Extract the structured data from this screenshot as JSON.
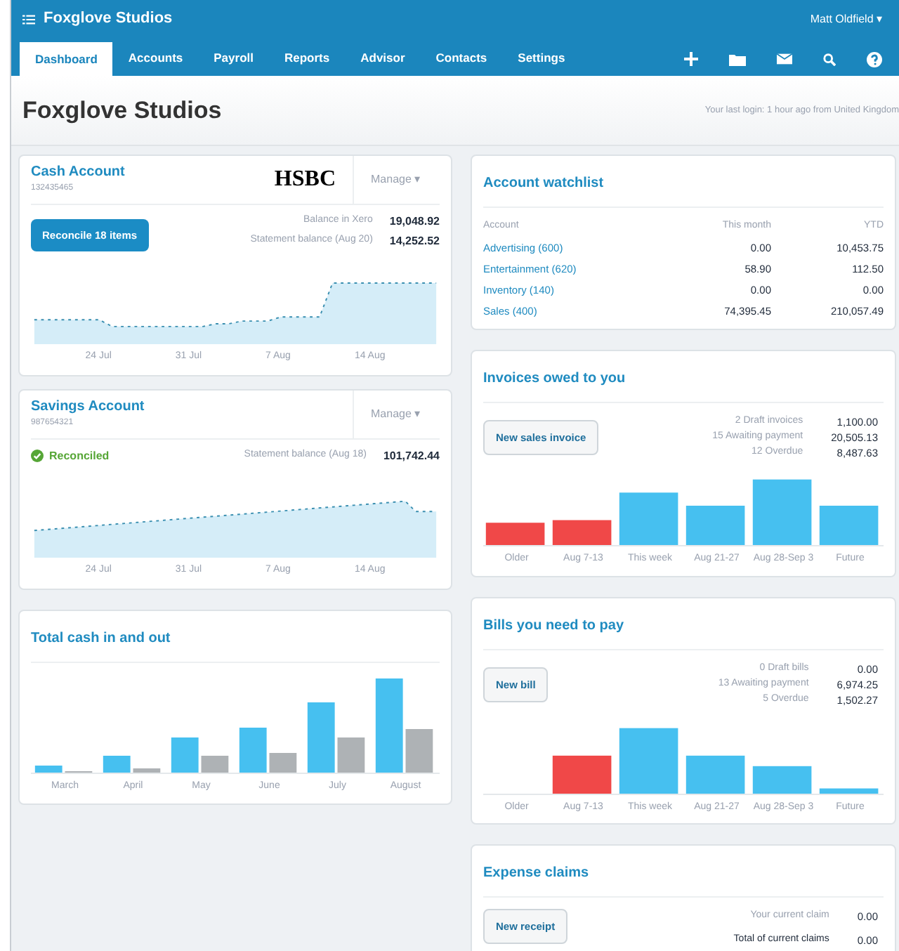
{
  "header": {
    "org": "Foxglove Studios",
    "user": "Matt Oldfield",
    "user_caret": "▾"
  },
  "nav": [
    {
      "label": "Dashboard",
      "selected": true
    },
    {
      "label": "Accounts",
      "selected": false
    },
    {
      "label": "Payroll",
      "selected": false
    },
    {
      "label": "Reports",
      "selected": false
    },
    {
      "label": "Advisor",
      "selected": false
    },
    {
      "label": "Contacts",
      "selected": false
    },
    {
      "label": "Settings",
      "selected": false
    }
  ],
  "page": {
    "title": "Foxglove Studios",
    "last_login": "Your last login: 1 hour ago from United Kingdom"
  },
  "bank_accounts": [
    {
      "name": "Cash Account",
      "number": "132435465",
      "bank_logo": "HSBC",
      "manage": "Manage",
      "manage_caret": "▾",
      "reconciled": false,
      "action": "Reconcile 18 items",
      "balances": [
        {
          "label": "Balance in Xero",
          "value": "19,048.92"
        },
        {
          "label": "Statement balance (Aug 20)",
          "value": "14,252.52"
        }
      ],
      "dates": [
        "24 Jul",
        "31 Jul",
        "7 Aug",
        "14 Aug"
      ]
    },
    {
      "name": "Savings Account",
      "number": "987654321",
      "manage": "Manage",
      "manage_caret": "▾",
      "reconciled": true,
      "status": "Reconciled",
      "balances": [
        {
          "label": "Statement balance (Aug 18)",
          "value": "101,742.44"
        }
      ],
      "dates": [
        "24 Jul",
        "31 Jul",
        "7 Aug",
        "14 Aug"
      ]
    }
  ],
  "cash_in_out": {
    "title": "Total cash in and out",
    "months": [
      "March",
      "April",
      "May",
      "June",
      "July",
      "August"
    ]
  },
  "watchlist": {
    "title": "Account watchlist",
    "columns": [
      "Account",
      "This month",
      "YTD"
    ],
    "rows": [
      {
        "account": "Advertising (600)",
        "this_month": "0.00",
        "ytd": "10,453.75"
      },
      {
        "account": "Entertainment (620)",
        "this_month": "58.90",
        "ytd": "112.50"
      },
      {
        "account": "Inventory (140)",
        "this_month": "0.00",
        "ytd": "0.00"
      },
      {
        "account": "Sales (400)",
        "this_month": "74,395.45",
        "ytd": "210,057.49"
      }
    ]
  },
  "invoices": {
    "title": "Invoices owed to you",
    "button": "New sales invoice",
    "summary": [
      {
        "label": "2 Draft invoices",
        "value": "1,100.00"
      },
      {
        "label": "15 Awaiting payment",
        "value": "20,505.13"
      },
      {
        "label": "12 Overdue",
        "value": "8,487.63"
      }
    ],
    "periods": [
      "Older",
      "Aug 7-13",
      "This week",
      "Aug 21-27",
      "Aug 28-Sep 3",
      "Future"
    ]
  },
  "bills": {
    "title": "Bills you need to pay",
    "button": "New bill",
    "summary": [
      {
        "label": "0 Draft bills",
        "value": "0.00"
      },
      {
        "label": "13 Awaiting payment",
        "value": "6,974.25"
      },
      {
        "label": "5 Overdue",
        "value": "1,502.27"
      }
    ],
    "periods": [
      "Older",
      "Aug 7-13",
      "This week",
      "Aug 21-27",
      "Aug 28-Sep 3",
      "Future"
    ]
  },
  "expenses": {
    "title": "Expense claims",
    "button": "New receipt",
    "summary": [
      {
        "label": "Your current claim",
        "value": "0.00"
      },
      {
        "label": "Total of current claims",
        "value": "0.00"
      }
    ]
  }
}
